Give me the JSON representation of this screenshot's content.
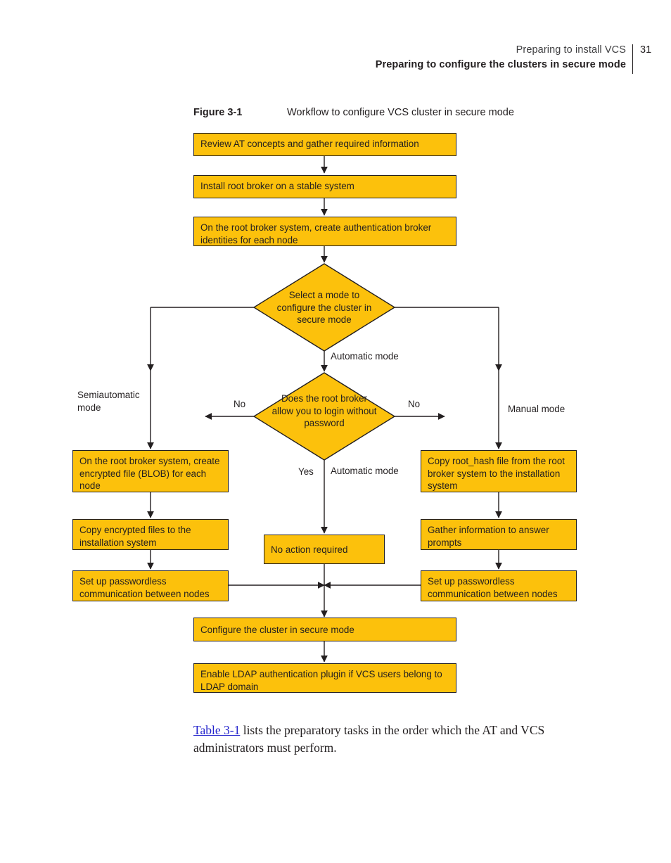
{
  "header": {
    "line1": "Preparing to install VCS",
    "line2": "Preparing to configure the clusters in secure mode",
    "page_number": "31"
  },
  "figure": {
    "label": "Figure 3-1",
    "title": "Workflow to configure VCS cluster in secure mode"
  },
  "colors": {
    "node_fill": "#fcc10c",
    "node_stroke": "#231f20",
    "link": "#2222cc",
    "text": "#231f20"
  },
  "flowchart": {
    "nodes": {
      "review_at": "Review AT concepts and gather required information",
      "install_root_broker": "Install root broker on a stable system",
      "create_identities": "On the root broker system, create authentication broker identities for each node",
      "select_mode": "Select a mode to configure the cluster in secure mode",
      "root_broker_login": "Does the root broker allow you to login without password",
      "create_blob": "On the root broker system, create encrypted file (BLOB) for each node",
      "copy_encrypted": "Copy encrypted files to the installation system",
      "setup_passwordless_left": "Set up passwordless communication between nodes",
      "no_action": "No action required",
      "copy_root_hash": "Copy root_hash file from the root broker system to the installation system",
      "gather_info": "Gather information to answer prompts",
      "setup_passwordless_right": "Set up passwordless communication between nodes",
      "configure_cluster": "Configure the cluster in secure mode",
      "enable_ldap": "Enable LDAP authentication plugin if VCS users belong to LDAP domain"
    },
    "edge_labels": {
      "semiautomatic_mode": "Semiautomatic\nmode",
      "automatic_mode_top": "Automatic mode",
      "manual_mode": "Manual mode",
      "no_left": "No",
      "no_right": "No",
      "yes": "Yes",
      "automatic_mode_bottom": "Automatic mode"
    }
  },
  "body": {
    "paragraph_link": "Table 3-1",
    "paragraph_rest": " lists the preparatory tasks in the order which the AT and VCS administrators must perform."
  }
}
